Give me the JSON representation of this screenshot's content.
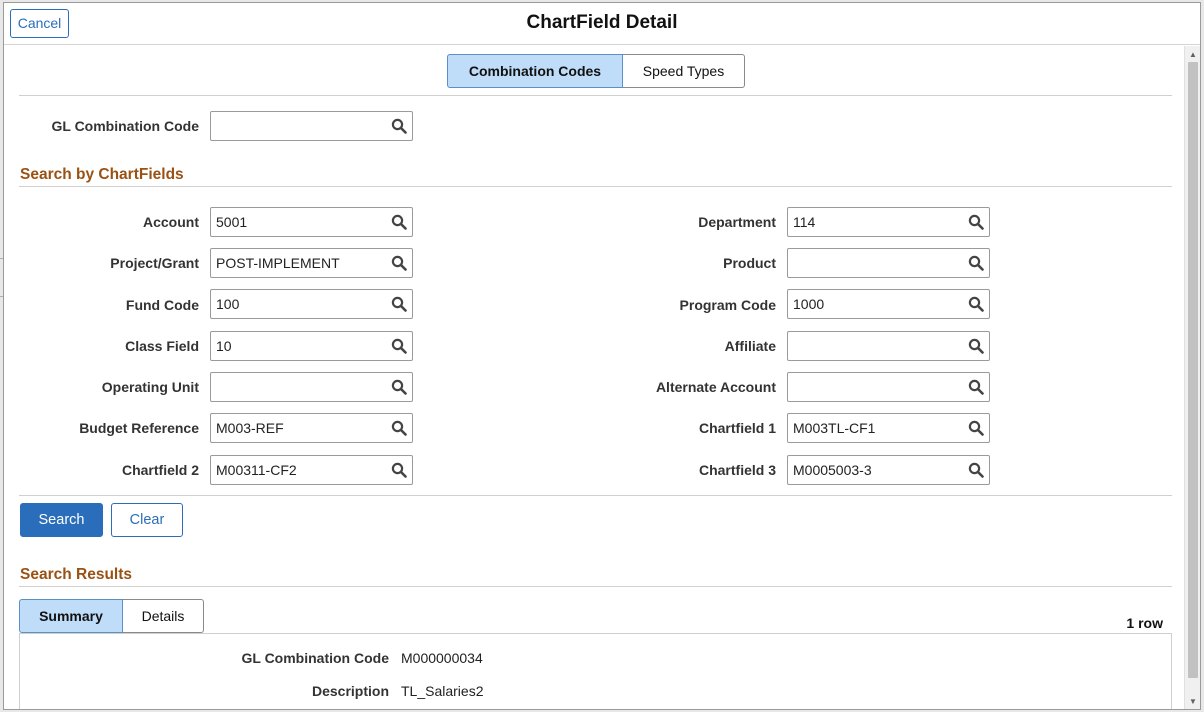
{
  "header": {
    "title": "ChartField Detail",
    "cancel_label": "Cancel"
  },
  "top_tabs": [
    {
      "label": "Combination Codes",
      "active": true
    },
    {
      "label": "Speed Types",
      "active": false
    }
  ],
  "gl_combination": {
    "label": "GL Combination Code",
    "value": ""
  },
  "search_by_chartfields": {
    "title": "Search by ChartFields",
    "left": [
      {
        "label": "Account",
        "value": "5001"
      },
      {
        "label": "Project/Grant",
        "value": "POST-IMPLEMENT"
      },
      {
        "label": "Fund Code",
        "value": "100"
      },
      {
        "label": "Class Field",
        "value": "10"
      },
      {
        "label": "Operating Unit",
        "value": ""
      },
      {
        "label": "Budget Reference",
        "value": "M003-REF"
      },
      {
        "label": "Chartfield 2",
        "value": "M00311-CF2"
      }
    ],
    "right": [
      {
        "label": "Department",
        "value": "114"
      },
      {
        "label": "Product",
        "value": ""
      },
      {
        "label": "Program Code",
        "value": "1000"
      },
      {
        "label": "Affiliate",
        "value": ""
      },
      {
        "label": "Alternate Account",
        "value": ""
      },
      {
        "label": "Chartfield 1",
        "value": "M003TL-CF1"
      },
      {
        "label": "Chartfield 3",
        "value": "M0005003-3"
      }
    ]
  },
  "actions": {
    "search_label": "Search",
    "clear_label": "Clear"
  },
  "search_results": {
    "title": "Search Results",
    "tabs": [
      {
        "label": "Summary",
        "active": true
      },
      {
        "label": "Details",
        "active": false
      }
    ],
    "row_count": "1 row",
    "rows": [
      {
        "label": "GL Combination Code",
        "value": "M000000034"
      },
      {
        "label": "Description",
        "value": "TL_Salaries2"
      }
    ]
  },
  "icons": {
    "lookup": "search-icon"
  },
  "colors": {
    "accent": "#2a6ebb",
    "section_title": "#9a5214",
    "active_tab": "#bfdcf8"
  }
}
